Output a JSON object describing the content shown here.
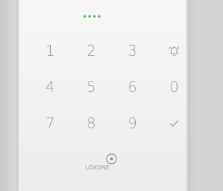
{
  "status": {
    "dots": 4,
    "color": "#2fbf4a"
  },
  "keypad": {
    "keys": [
      {
        "label": "1"
      },
      {
        "label": "2"
      },
      {
        "label": "3"
      },
      {
        "icon": "bell-icon"
      },
      {
        "label": "4"
      },
      {
        "label": "5"
      },
      {
        "label": "6"
      },
      {
        "label": "0"
      },
      {
        "label": "7"
      },
      {
        "label": "8"
      },
      {
        "label": "9"
      },
      {
        "icon": "check-icon"
      },
      {
        "icon": "home-circle-icon"
      }
    ]
  },
  "brand": {
    "logo_text": "LOXONE"
  }
}
